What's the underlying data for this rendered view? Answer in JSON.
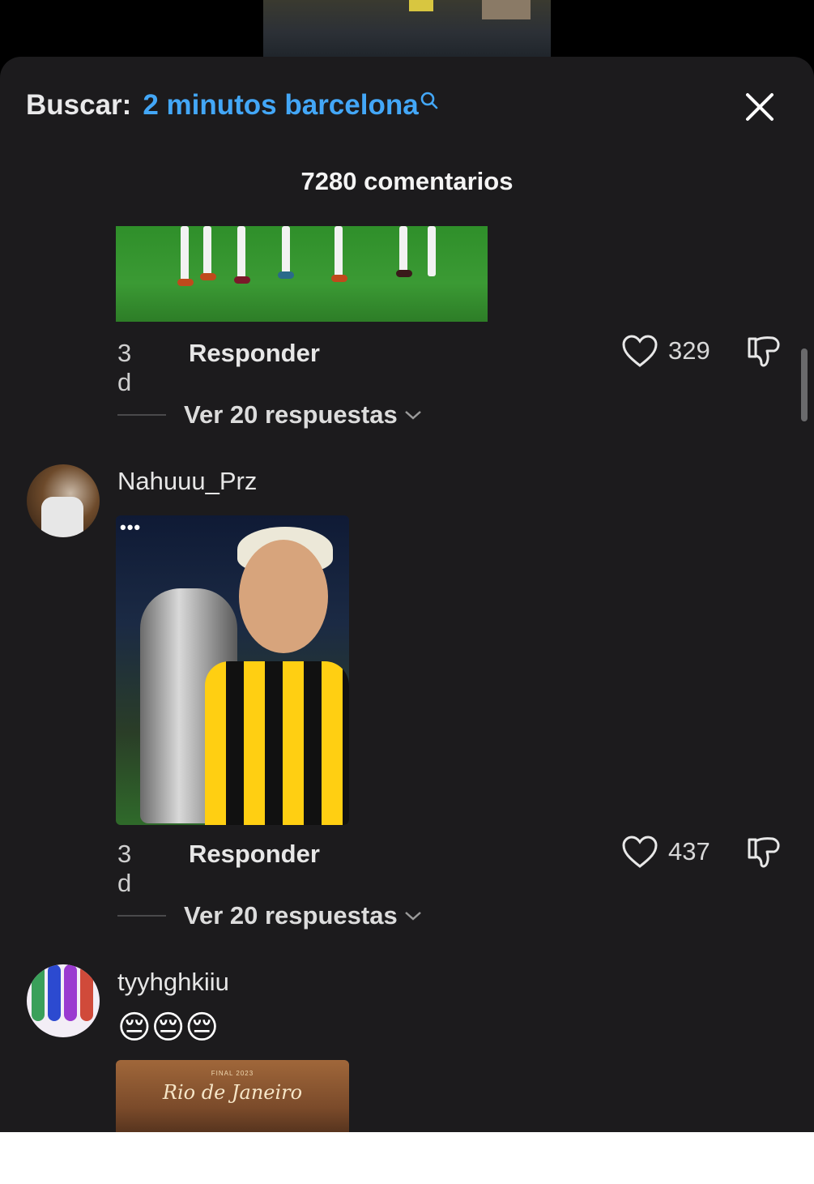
{
  "header": {
    "search_label": "Buscar:",
    "search_query": "2 minutos barcelona",
    "comment_count": "7280 comentarios"
  },
  "comments": [
    {
      "time": "3 d",
      "reply_label": "Responder",
      "likes": "329",
      "replies_label": "Ver 20 respuestas"
    },
    {
      "username": "Nahuuu_Prz",
      "time": "3 d",
      "reply_label": "Responder",
      "likes": "437",
      "replies_label": "Ver 20 respuestas"
    },
    {
      "username": "tyyhghkiiu",
      "text": "😔😔😔",
      "image_title": "Rio de Janeiro",
      "image_subtitle": "FINAL 2023"
    }
  ],
  "colors": {
    "accent": "#43a7f7",
    "panel": "#1c1b1d"
  },
  "icons": [
    "search-icon",
    "close-icon",
    "heart-icon",
    "dislike-icon",
    "chevron-down-icon"
  ]
}
